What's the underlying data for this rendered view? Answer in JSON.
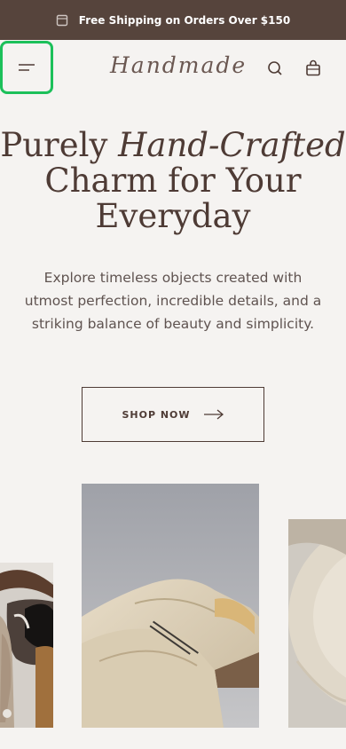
{
  "announcement": {
    "icon": "gift-icon",
    "text": "Free Shipping on Orders Over $150"
  },
  "header": {
    "menu_icon": "hamburger-menu-icon",
    "logo": "Handmade",
    "search_icon": "search-icon",
    "cart_icon": "shopping-bag-icon"
  },
  "hero": {
    "title_plain_1": "Purely ",
    "title_italic": "Hand-Crafted",
    "title_plain_2": "Charm for Your",
    "title_plain_3": "Everyday",
    "subtitle": "Explore timeless objects created with utmost perfection, incredible details, and a striking balance of beauty and simplicity.",
    "cta_label": "SHOP NOW",
    "cta_icon": "arrow-right-icon"
  },
  "gallery": {
    "images": [
      "hats-photo",
      "tote-bag-photo",
      "ceramic-plate-photo"
    ]
  },
  "colors": {
    "announcement_bg": "#56443c",
    "page_bg": "#f5f3f1",
    "text_brown": "#4e3b35",
    "focus_green": "#1cc05a"
  }
}
